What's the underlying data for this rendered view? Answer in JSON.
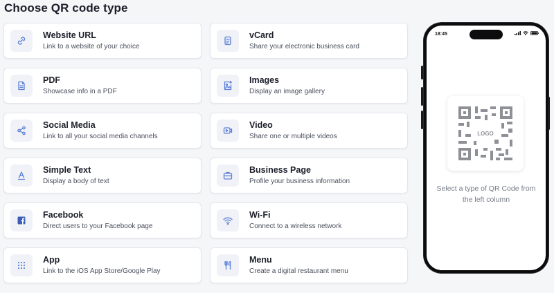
{
  "page": {
    "title": "Choose QR code type"
  },
  "accent_color": "#5b7fd6",
  "types": [
    {
      "title": "Website URL",
      "desc": "Link to a website of your choice",
      "icon": "link-icon"
    },
    {
      "title": "vCard",
      "desc": "Share your electronic business card",
      "icon": "vcard-icon"
    },
    {
      "title": "PDF",
      "desc": "Showcase info in a PDF",
      "icon": "pdf-icon"
    },
    {
      "title": "Images",
      "desc": "Display an image gallery",
      "icon": "image-icon"
    },
    {
      "title": "Social Media",
      "desc": "Link to all your social media channels",
      "icon": "share-icon"
    },
    {
      "title": "Video",
      "desc": "Share one or multiple videos",
      "icon": "video-icon"
    },
    {
      "title": "Simple Text",
      "desc": "Display a body of text",
      "icon": "text-icon"
    },
    {
      "title": "Business Page",
      "desc": "Profile your business information",
      "icon": "briefcase-icon"
    },
    {
      "title": "Facebook",
      "desc": "Direct users to your Facebook page",
      "icon": "facebook-icon"
    },
    {
      "title": "Wi-Fi",
      "desc": "Connect to a wireless network",
      "icon": "wifi-icon"
    },
    {
      "title": "App",
      "desc": "Link to the iOS App Store/Google Play",
      "icon": "app-grid-icon"
    },
    {
      "title": "Menu",
      "desc": "Create a digital restaurant menu",
      "icon": "fork-knife-icon"
    }
  ],
  "preview": {
    "time": "18:45",
    "qr_label": "LOGO",
    "hint": "Select a type of QR Code from the left column"
  }
}
